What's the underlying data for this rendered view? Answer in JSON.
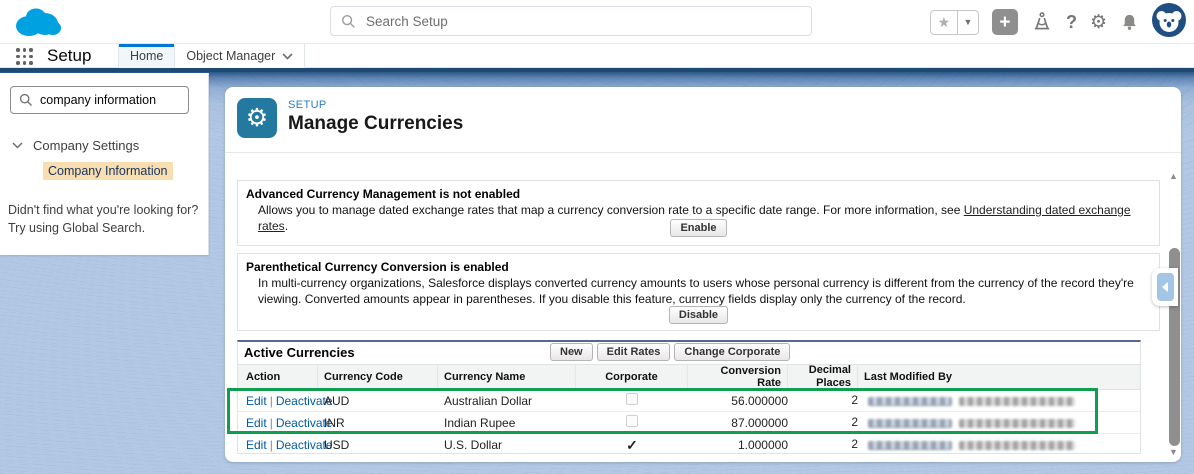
{
  "header": {
    "search_placeholder": "Search Setup"
  },
  "nav": {
    "app_label": "Setup",
    "tabs": [
      {
        "label": "Home"
      },
      {
        "label": "Object Manager"
      }
    ]
  },
  "sidebar": {
    "search_value": "company information",
    "tree_group": "Company Settings",
    "tree_item": "Company Information",
    "help_text": "Didn't find what you're looking for? Try using Global Search."
  },
  "page_header": {
    "eyebrow": "SETUP",
    "title": "Manage Currencies",
    "icon": "gear-icon",
    "icon_glyph": "⚙",
    "tile_color": "#2379a0"
  },
  "sections": {
    "acm": {
      "title": "Advanced Currency Management is not enabled",
      "body_before_link": "Allows you to manage dated exchange rates that map a currency conversion rate to a specific date range. For more information, see ",
      "link_text": "Understanding dated exchange rates",
      "body_after_link": ".",
      "button_label": "Enable"
    },
    "pcc": {
      "title": "Parenthetical Currency Conversion is enabled",
      "body": "In multi-currency organizations, Salesforce displays converted currency amounts to users whose personal currency is different from the currency of the record they're viewing. Converted amounts appear in parentheses. If you disable this feature, currency fields display only the currency of the record.",
      "button_label": "Disable"
    }
  },
  "active_currencies": {
    "title": "Active Currencies",
    "buttons": [
      "New",
      "Edit Rates",
      "Change Corporate"
    ],
    "columns": [
      "Action",
      "Currency Code",
      "Currency Name",
      "Corporate",
      "Conversion Rate",
      "Decimal Places",
      "Last Modified By"
    ],
    "action_links": [
      "Edit",
      "Deactivate"
    ],
    "action_separator": "|",
    "corporate_check_glyph": "✓",
    "rows": [
      {
        "code": "AUD",
        "name": "Australian Dollar",
        "corporate": false,
        "conversion_rate": "56.000000",
        "decimal_places": "2",
        "last_modified_redacted": true
      },
      {
        "code": "INR",
        "name": "Indian Rupee",
        "corporate": false,
        "conversion_rate": "87.000000",
        "decimal_places": "2",
        "last_modified_redacted": true
      },
      {
        "code": "USD",
        "name": "U.S. Dollar",
        "corporate": true,
        "conversion_rate": "1.000000",
        "decimal_places": "2",
        "last_modified_redacted": true
      }
    ]
  },
  "annotation": {
    "highlight_color": "#0f9d4f",
    "highlighted_rows": [
      "AUD",
      "INR"
    ]
  },
  "colors": {
    "brand_blue": "#0176d3",
    "cloud_logo": "#00a1e0",
    "page_background": "#b2c8e4",
    "link": "#015ba7",
    "section_top_border": "#54698d",
    "tree_highlight": "#f8dfb2"
  }
}
